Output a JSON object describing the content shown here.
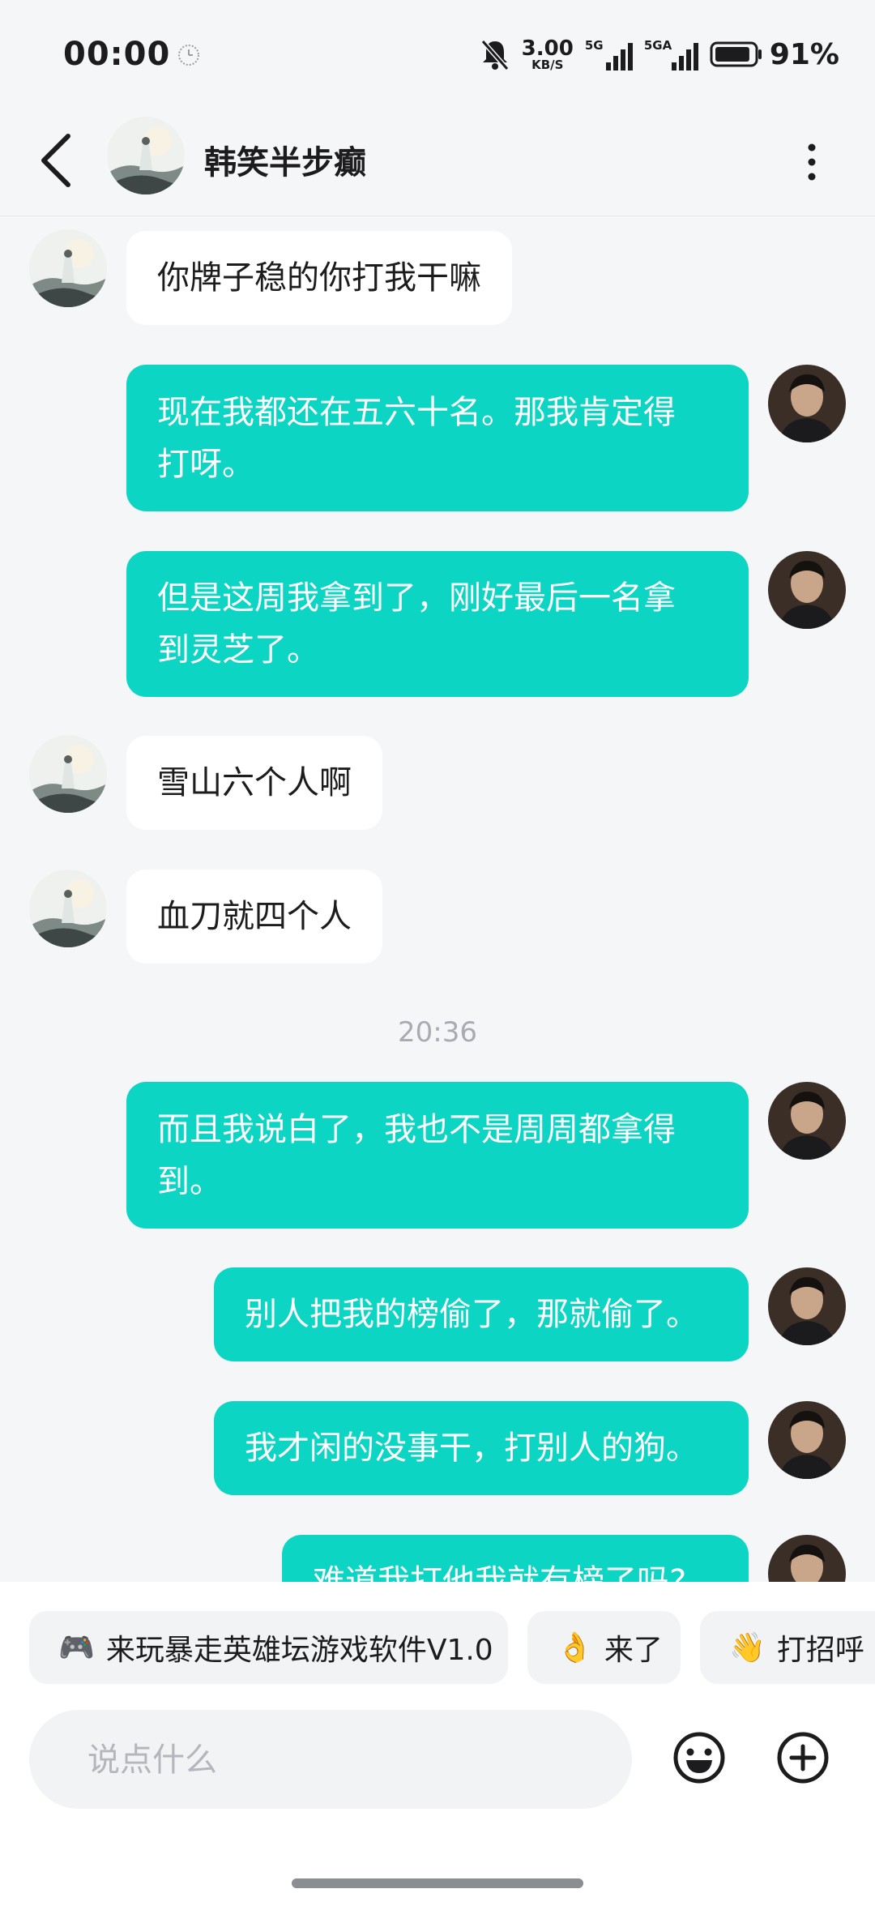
{
  "status_bar": {
    "time": "00:00",
    "net_speed_value": "3.00",
    "net_speed_unit": "KB/S",
    "signal1_label": "5G",
    "signal2_label": "5GA",
    "battery_percent": "91%",
    "battery_level": 0.91
  },
  "header": {
    "title": "韩笑半步癫"
  },
  "messages": [
    {
      "side": "in",
      "text": "你牌子稳的你打我干嘛"
    },
    {
      "side": "out",
      "line1": "现在我都还在五六十名。那我肯定得",
      "line2": "打呀。"
    },
    {
      "side": "out",
      "line1": "但是这周我拿到了，刚好最后一名拿",
      "line2": "到灵芝了。"
    },
    {
      "side": "in",
      "text": "雪山六个人啊"
    },
    {
      "side": "in",
      "text": "血刀就四个人"
    },
    {
      "type": "time",
      "text": "20:36"
    },
    {
      "side": "out",
      "line1": "而且我说白了，我也不是周周都拿得",
      "line2": "到。"
    },
    {
      "side": "out",
      "text": "别人把我的榜偷了，那就偷了。"
    },
    {
      "side": "out",
      "text": "我才闲的没事干，打别人的狗。"
    },
    {
      "side": "out",
      "text": "难道我打他我就有榜了吗?"
    }
  ],
  "quick_replies": [
    {
      "emoji": "🎮",
      "label": "来玩暴走英雄坛游戏软件V1.0"
    },
    {
      "emoji": "👌",
      "label": "来了"
    },
    {
      "emoji": "👋",
      "label": "打招呼"
    }
  ],
  "input": {
    "placeholder": "说点什么",
    "value": ""
  },
  "icons": {
    "back": "chevron-left-icon",
    "more": "more-vertical-icon",
    "emoji": "smiley-icon",
    "plus": "plus-circle-icon"
  },
  "colors": {
    "outgoing_bubble": "#0dd5c4",
    "incoming_bubble": "#ffffff",
    "background": "#f5f6f8"
  }
}
